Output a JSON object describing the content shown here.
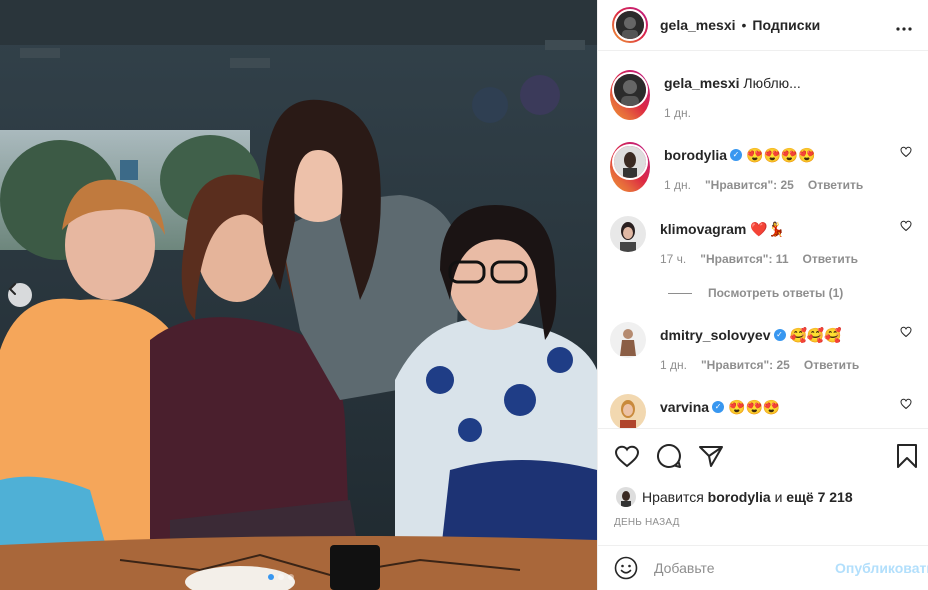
{
  "post": {
    "author": "gela_mesxi",
    "separator": "•",
    "follow_label": "Подписки",
    "more_icon": "more-horizontal-icon",
    "caption_text": "Люблю...",
    "caption_time": "1 дн."
  },
  "comments": [
    {
      "username": "borodylia",
      "verified": true,
      "text": "😍😍😍😍",
      "time": "1 дн.",
      "likes": "\"Нравится\": 25",
      "reply": "Ответить"
    },
    {
      "username": "klimovagram",
      "verified": false,
      "text": "❤️💃",
      "time": "17 ч.",
      "likes": "\"Нравится\": 11",
      "reply": "Ответить"
    },
    {
      "username": "dmitry_solovyev",
      "verified": true,
      "text": "🥰🥰🥰",
      "time": "1 дн.",
      "likes": "\"Нравится\": 25",
      "reply": "Ответить"
    },
    {
      "username": "varvina",
      "verified": true,
      "text": "😍😍😍"
    }
  ],
  "view_replies": "Посмотреть ответы (1)",
  "likes_line": {
    "prefix": "Нравится",
    "user": "borodylia",
    "and": "и",
    "others": "ещё 7 218"
  },
  "timestamp": "ДЕНЬ НАЗАД",
  "add_comment": {
    "placeholder": "Добавьте",
    "post_label": "Опубликовать"
  },
  "carousel": {
    "slides": 3,
    "active": 0
  },
  "colors": {
    "accent": "#3897f0",
    "post_disabled": "#b2dffc",
    "muted": "#8e8e8e",
    "text": "#262626"
  }
}
